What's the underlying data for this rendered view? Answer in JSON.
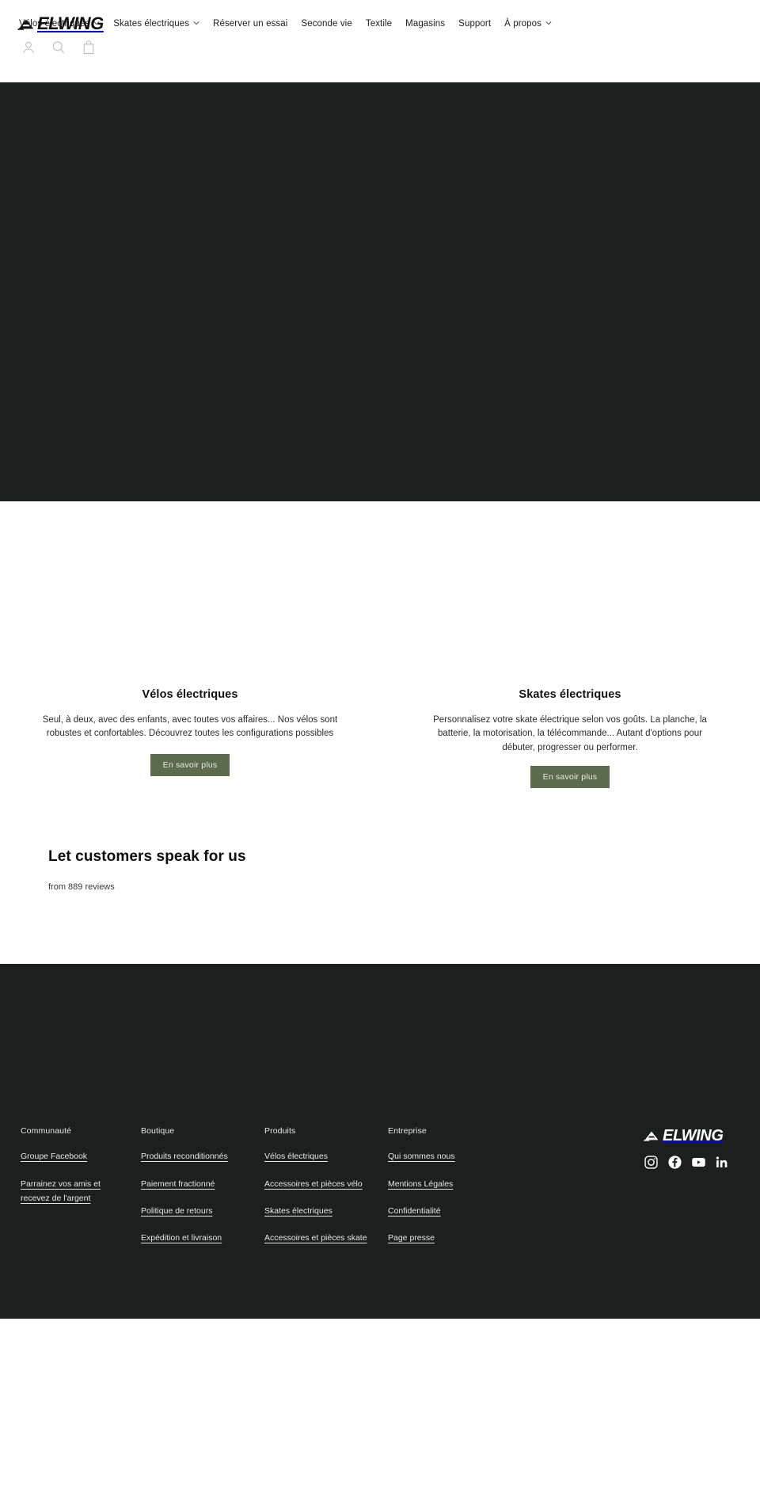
{
  "brand": {
    "name": "ELWING",
    "mark_icon": "elwing-triangle-icon"
  },
  "header": {
    "nav": [
      {
        "label": "Vélos électriques",
        "has_dropdown": true
      },
      {
        "label": "Skates électriques",
        "has_dropdown": true
      },
      {
        "label": "Réserver un essai",
        "has_dropdown": false
      },
      {
        "label": "Seconde vie",
        "has_dropdown": false
      },
      {
        "label": "Textile",
        "has_dropdown": false
      },
      {
        "label": "Magasins",
        "has_dropdown": false
      },
      {
        "label": "Support",
        "has_dropdown": false
      },
      {
        "label": "À propos",
        "has_dropdown": true
      }
    ],
    "icons": [
      {
        "name": "account-icon"
      },
      {
        "name": "search-icon"
      },
      {
        "name": "cart-icon"
      }
    ]
  },
  "features": [
    {
      "title": "Vélos électriques",
      "description": "Seul, à deux, avec des enfants, avec toutes vos affaires... Nos vélos sont robustes et confortables. Découvrez toutes les configurations possibles",
      "button_label": "En savoir plus"
    },
    {
      "title": "Skates électriques",
      "description": "Personnalisez votre skate électrique selon vos goûts. La planche, la batterie, la motorisation, la télécommande... Autant d'options pour débuter, progresser ou performer.",
      "button_label": "En savoir plus"
    }
  ],
  "reviews": {
    "heading": "Let customers speak for us",
    "subtext": "from 889 reviews"
  },
  "footer": {
    "columns": [
      {
        "heading": "Communauté",
        "links": [
          "Groupe Facebook",
          "Parrainez vos amis et recevez de l'argent"
        ]
      },
      {
        "heading": "Boutique",
        "links": [
          "Produits reconditionnés",
          "Paiement fractionné",
          "Politique de retours",
          "Expédition et livraison"
        ]
      },
      {
        "heading": "Produits",
        "links": [
          "Vélos électriques",
          "Accessoires et pièces vélo",
          "Skates électriques",
          "Accessoires et pièces skate"
        ]
      },
      {
        "heading": "Entreprise",
        "links": [
          "Qui sommes nous",
          "Mentions Légales",
          "Confidentialité",
          "Page presse"
        ]
      }
    ],
    "socials": [
      {
        "name": "instagram-icon"
      },
      {
        "name": "facebook-icon"
      },
      {
        "name": "youtube-icon"
      },
      {
        "name": "linkedin-icon"
      }
    ]
  },
  "colors": {
    "dark": "#1d1f1e",
    "button_green": "#5d6b4d",
    "text_dark": "#111111"
  }
}
